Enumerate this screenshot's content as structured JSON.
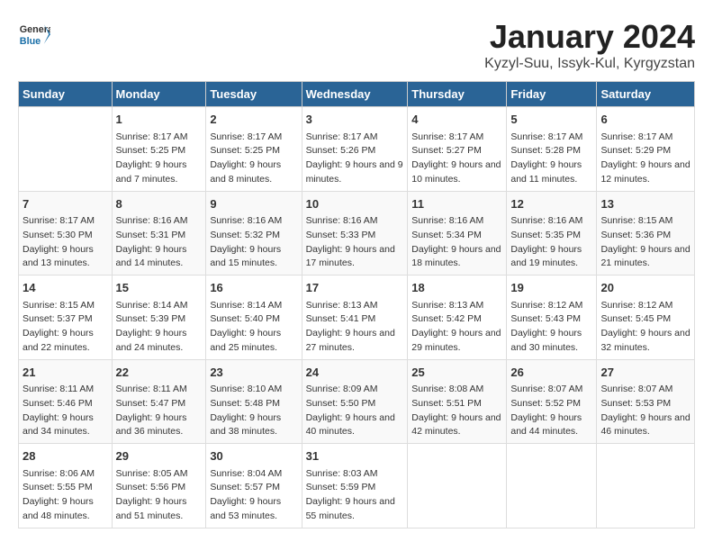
{
  "header": {
    "logo_general": "General",
    "logo_blue": "Blue",
    "title": "January 2024",
    "subtitle": "Kyzyl-Suu, Issyk-Kul, Kyrgyzstan"
  },
  "columns": [
    "Sunday",
    "Monday",
    "Tuesday",
    "Wednesday",
    "Thursday",
    "Friday",
    "Saturday"
  ],
  "weeks": [
    [
      {
        "day": "",
        "sunrise": "",
        "sunset": "",
        "daylight": ""
      },
      {
        "day": "1",
        "sunrise": "Sunrise: 8:17 AM",
        "sunset": "Sunset: 5:25 PM",
        "daylight": "Daylight: 9 hours and 7 minutes."
      },
      {
        "day": "2",
        "sunrise": "Sunrise: 8:17 AM",
        "sunset": "Sunset: 5:25 PM",
        "daylight": "Daylight: 9 hours and 8 minutes."
      },
      {
        "day": "3",
        "sunrise": "Sunrise: 8:17 AM",
        "sunset": "Sunset: 5:26 PM",
        "daylight": "Daylight: 9 hours and 9 minutes."
      },
      {
        "day": "4",
        "sunrise": "Sunrise: 8:17 AM",
        "sunset": "Sunset: 5:27 PM",
        "daylight": "Daylight: 9 hours and 10 minutes."
      },
      {
        "day": "5",
        "sunrise": "Sunrise: 8:17 AM",
        "sunset": "Sunset: 5:28 PM",
        "daylight": "Daylight: 9 hours and 11 minutes."
      },
      {
        "day": "6",
        "sunrise": "Sunrise: 8:17 AM",
        "sunset": "Sunset: 5:29 PM",
        "daylight": "Daylight: 9 hours and 12 minutes."
      }
    ],
    [
      {
        "day": "7",
        "sunrise": "Sunrise: 8:17 AM",
        "sunset": "Sunset: 5:30 PM",
        "daylight": "Daylight: 9 hours and 13 minutes."
      },
      {
        "day": "8",
        "sunrise": "Sunrise: 8:16 AM",
        "sunset": "Sunset: 5:31 PM",
        "daylight": "Daylight: 9 hours and 14 minutes."
      },
      {
        "day": "9",
        "sunrise": "Sunrise: 8:16 AM",
        "sunset": "Sunset: 5:32 PM",
        "daylight": "Daylight: 9 hours and 15 minutes."
      },
      {
        "day": "10",
        "sunrise": "Sunrise: 8:16 AM",
        "sunset": "Sunset: 5:33 PM",
        "daylight": "Daylight: 9 hours and 17 minutes."
      },
      {
        "day": "11",
        "sunrise": "Sunrise: 8:16 AM",
        "sunset": "Sunset: 5:34 PM",
        "daylight": "Daylight: 9 hours and 18 minutes."
      },
      {
        "day": "12",
        "sunrise": "Sunrise: 8:16 AM",
        "sunset": "Sunset: 5:35 PM",
        "daylight": "Daylight: 9 hours and 19 minutes."
      },
      {
        "day": "13",
        "sunrise": "Sunrise: 8:15 AM",
        "sunset": "Sunset: 5:36 PM",
        "daylight": "Daylight: 9 hours and 21 minutes."
      }
    ],
    [
      {
        "day": "14",
        "sunrise": "Sunrise: 8:15 AM",
        "sunset": "Sunset: 5:37 PM",
        "daylight": "Daylight: 9 hours and 22 minutes."
      },
      {
        "day": "15",
        "sunrise": "Sunrise: 8:14 AM",
        "sunset": "Sunset: 5:39 PM",
        "daylight": "Daylight: 9 hours and 24 minutes."
      },
      {
        "day": "16",
        "sunrise": "Sunrise: 8:14 AM",
        "sunset": "Sunset: 5:40 PM",
        "daylight": "Daylight: 9 hours and 25 minutes."
      },
      {
        "day": "17",
        "sunrise": "Sunrise: 8:13 AM",
        "sunset": "Sunset: 5:41 PM",
        "daylight": "Daylight: 9 hours and 27 minutes."
      },
      {
        "day": "18",
        "sunrise": "Sunrise: 8:13 AM",
        "sunset": "Sunset: 5:42 PM",
        "daylight": "Daylight: 9 hours and 29 minutes."
      },
      {
        "day": "19",
        "sunrise": "Sunrise: 8:12 AM",
        "sunset": "Sunset: 5:43 PM",
        "daylight": "Daylight: 9 hours and 30 minutes."
      },
      {
        "day": "20",
        "sunrise": "Sunrise: 8:12 AM",
        "sunset": "Sunset: 5:45 PM",
        "daylight": "Daylight: 9 hours and 32 minutes."
      }
    ],
    [
      {
        "day": "21",
        "sunrise": "Sunrise: 8:11 AM",
        "sunset": "Sunset: 5:46 PM",
        "daylight": "Daylight: 9 hours and 34 minutes."
      },
      {
        "day": "22",
        "sunrise": "Sunrise: 8:11 AM",
        "sunset": "Sunset: 5:47 PM",
        "daylight": "Daylight: 9 hours and 36 minutes."
      },
      {
        "day": "23",
        "sunrise": "Sunrise: 8:10 AM",
        "sunset": "Sunset: 5:48 PM",
        "daylight": "Daylight: 9 hours and 38 minutes."
      },
      {
        "day": "24",
        "sunrise": "Sunrise: 8:09 AM",
        "sunset": "Sunset: 5:50 PM",
        "daylight": "Daylight: 9 hours and 40 minutes."
      },
      {
        "day": "25",
        "sunrise": "Sunrise: 8:08 AM",
        "sunset": "Sunset: 5:51 PM",
        "daylight": "Daylight: 9 hours and 42 minutes."
      },
      {
        "day": "26",
        "sunrise": "Sunrise: 8:07 AM",
        "sunset": "Sunset: 5:52 PM",
        "daylight": "Daylight: 9 hours and 44 minutes."
      },
      {
        "day": "27",
        "sunrise": "Sunrise: 8:07 AM",
        "sunset": "Sunset: 5:53 PM",
        "daylight": "Daylight: 9 hours and 46 minutes."
      }
    ],
    [
      {
        "day": "28",
        "sunrise": "Sunrise: 8:06 AM",
        "sunset": "Sunset: 5:55 PM",
        "daylight": "Daylight: 9 hours and 48 minutes."
      },
      {
        "day": "29",
        "sunrise": "Sunrise: 8:05 AM",
        "sunset": "Sunset: 5:56 PM",
        "daylight": "Daylight: 9 hours and 51 minutes."
      },
      {
        "day": "30",
        "sunrise": "Sunrise: 8:04 AM",
        "sunset": "Sunset: 5:57 PM",
        "daylight": "Daylight: 9 hours and 53 minutes."
      },
      {
        "day": "31",
        "sunrise": "Sunrise: 8:03 AM",
        "sunset": "Sunset: 5:59 PM",
        "daylight": "Daylight: 9 hours and 55 minutes."
      },
      {
        "day": "",
        "sunrise": "",
        "sunset": "",
        "daylight": ""
      },
      {
        "day": "",
        "sunrise": "",
        "sunset": "",
        "daylight": ""
      },
      {
        "day": "",
        "sunrise": "",
        "sunset": "",
        "daylight": ""
      }
    ]
  ]
}
